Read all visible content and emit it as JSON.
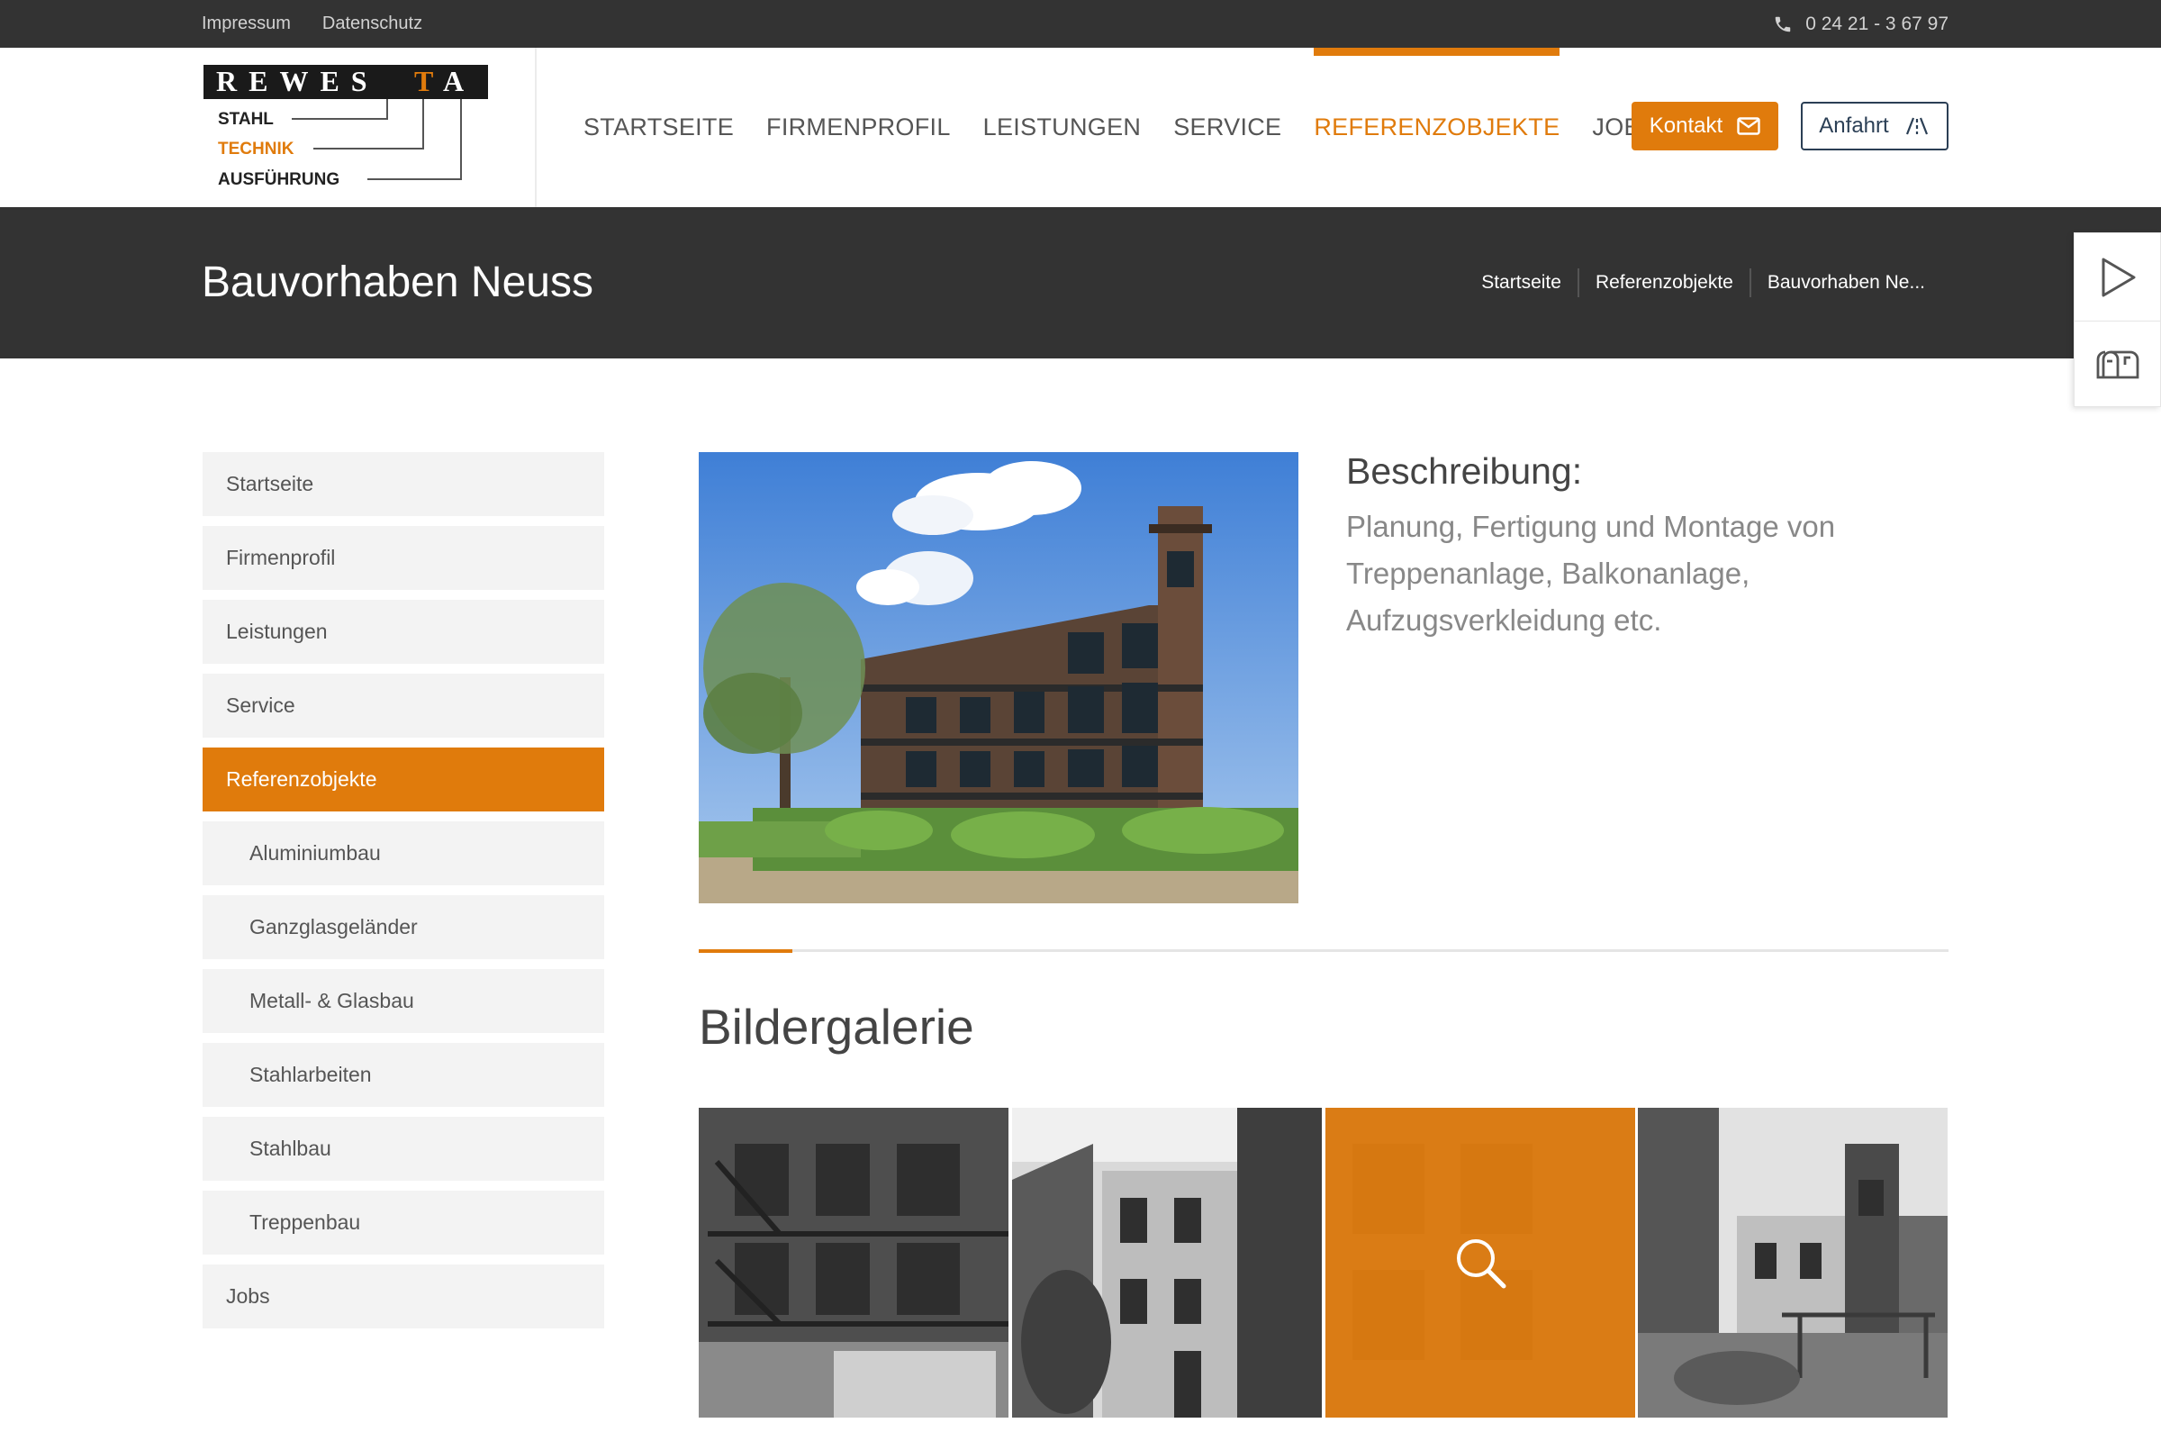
{
  "topbar": {
    "links": [
      "Impressum",
      "Datenschutz"
    ],
    "phone": "0 24 21 - 3 67 97"
  },
  "logo": {
    "brand": "REWESTA",
    "lines": [
      "STAHL",
      "TECHNIK",
      "AUSFÜHRUNG"
    ]
  },
  "nav": {
    "items": [
      "STARTSEITE",
      "FIRMENPROFIL",
      "LEISTUNGEN",
      "SERVICE",
      "REFERENZOBJEKTE",
      "JOBS"
    ],
    "active": "REFERENZOBJEKTE",
    "kontakt": "Kontakt",
    "anfahrt": "Anfahrt"
  },
  "page": {
    "title": "Bauvorhaben Neuss",
    "breadcrumb": [
      "Startseite",
      "Referenzobjekte",
      "Bauvorhaben Ne..."
    ]
  },
  "sidebar": {
    "items": [
      {
        "label": "Startseite",
        "sub": false,
        "active": false
      },
      {
        "label": "Firmenprofil",
        "sub": false,
        "active": false
      },
      {
        "label": "Leistungen",
        "sub": false,
        "active": false
      },
      {
        "label": "Service",
        "sub": false,
        "active": false
      },
      {
        "label": "Referenzobjekte",
        "sub": false,
        "active": true
      },
      {
        "label": "Aluminiumbau",
        "sub": true,
        "active": false
      },
      {
        "label": "Ganzglasgeländer",
        "sub": true,
        "active": false
      },
      {
        "label": "Metall- & Glasbau",
        "sub": true,
        "active": false
      },
      {
        "label": "Stahlarbeiten",
        "sub": true,
        "active": false
      },
      {
        "label": "Stahlbau",
        "sub": true,
        "active": false
      },
      {
        "label": "Treppenbau",
        "sub": true,
        "active": false
      },
      {
        "label": "Jobs",
        "sub": false,
        "active": false
      }
    ]
  },
  "description": {
    "heading": "Beschreibung:",
    "text": "Planung, Fertigung und Montage von Treppenanlage, Balkonanlage, Aufzugsverkleidung etc."
  },
  "gallery": {
    "title": "Bildergalerie",
    "count": 4,
    "hovered_index": 2
  },
  "colors": {
    "accent": "#e07b0c",
    "dark": "#333333",
    "navy": "#2b3f55"
  }
}
